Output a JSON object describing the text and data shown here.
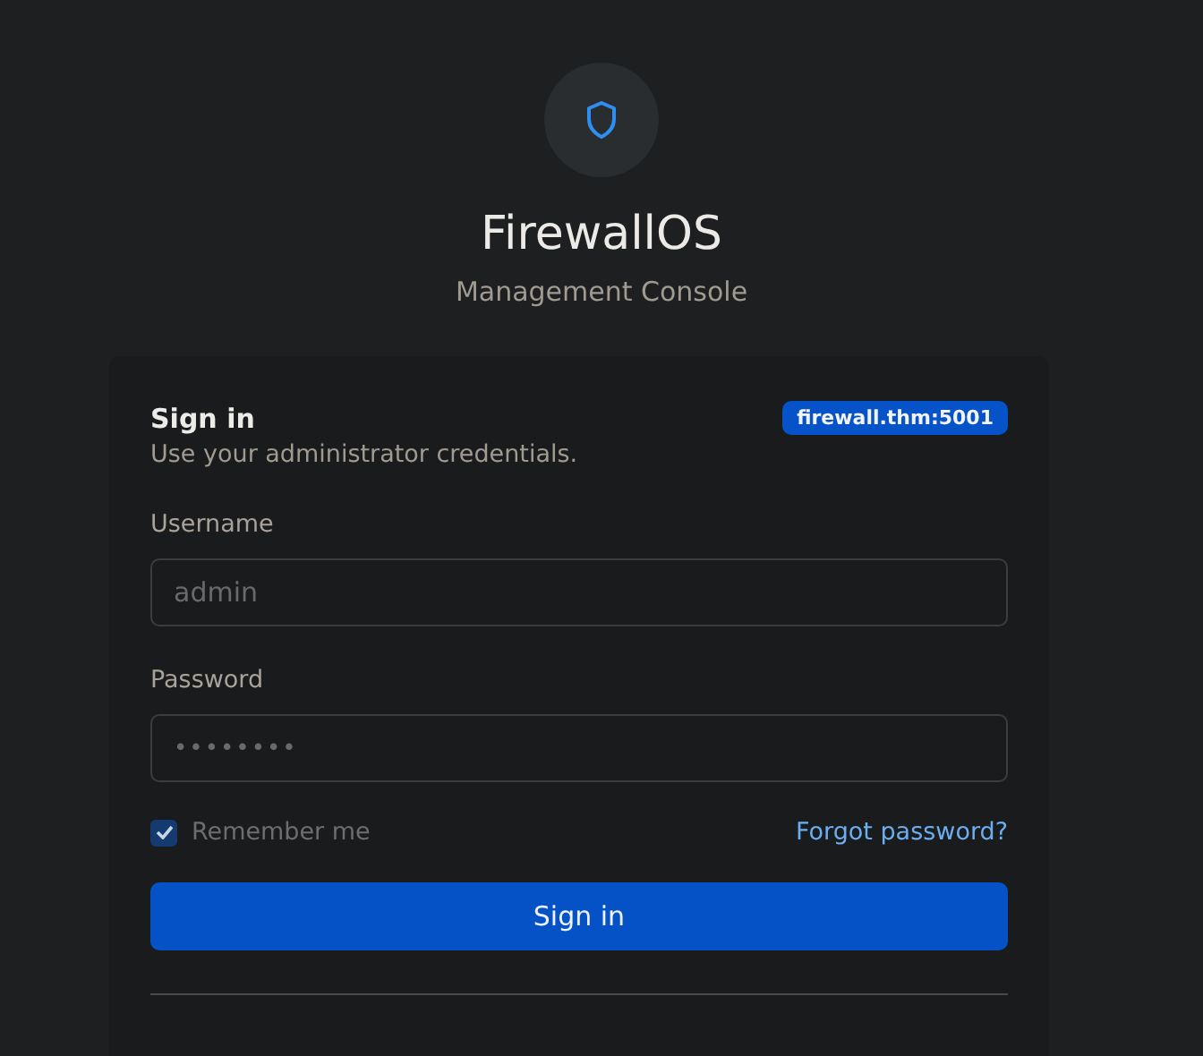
{
  "brand": {
    "title": "FirewallOS",
    "subtitle": "Management Console"
  },
  "card": {
    "title": "Sign in",
    "subtitle": "Use your administrator credentials.",
    "host_badge": "firewall.thm:5001",
    "fields": [
      {
        "label": "Username",
        "placeholder": "admin",
        "kind": "text"
      },
      {
        "label": "Password",
        "placeholder": "••••••••",
        "kind": "password"
      }
    ],
    "remember": {
      "label": "Remember me",
      "checked": true,
      "disabled": true
    },
    "forgot_link": "Forgot password?",
    "submit": "Sign in"
  }
}
